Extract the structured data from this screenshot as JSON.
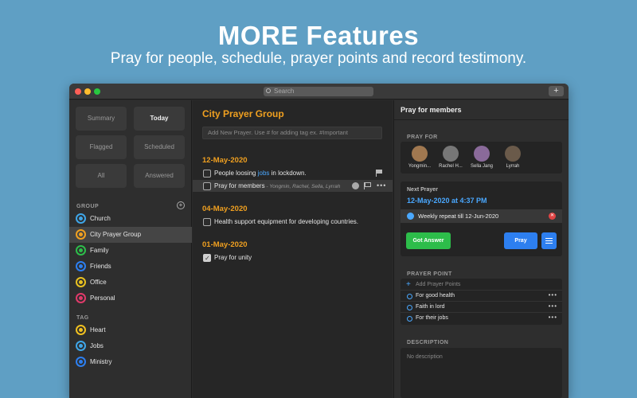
{
  "hero": {
    "title": "MORE Features",
    "subtitle": "Pray for people, schedule, prayer points and record testimony."
  },
  "window": {
    "search_placeholder": "Search",
    "add_label": "+"
  },
  "sidebar": {
    "tiles": {
      "summary": "Summary",
      "today": "Today",
      "flagged": "Flagged",
      "scheduled": "Scheduled",
      "all": "All",
      "answered": "Answered"
    },
    "group_label": "GROUP",
    "group_add": "+",
    "groups": [
      {
        "label": "Church",
        "color": "#3fa6e8"
      },
      {
        "label": "City Prayer Group",
        "color": "#f0a020"
      },
      {
        "label": "Family",
        "color": "#2dbd4a"
      },
      {
        "label": "Friends",
        "color": "#2d7ff0"
      },
      {
        "label": "Office",
        "color": "#e8c020"
      },
      {
        "label": "Personal",
        "color": "#e03a6a"
      }
    ],
    "tag_label": "TAG",
    "tags": [
      {
        "label": "Heart",
        "color": "#f0c020"
      },
      {
        "label": "Jobs",
        "color": "#3fa6e8"
      },
      {
        "label": "Ministry",
        "color": "#2d7ff0"
      }
    ]
  },
  "middle": {
    "title": "City Prayer Group",
    "add_placeholder": "Add New Prayer. Use # for adding tag ex. #Important",
    "sections": [
      {
        "date": "12-May-2020",
        "items": [
          {
            "pre": "People loosing ",
            "highlight": "jobs",
            "post": " in lockdown."
          },
          {
            "text": "Pray for members",
            "members": " - Yongmin, Rachel, Sella, Lyrrah"
          }
        ]
      },
      {
        "date": "04-May-2020",
        "items": [
          {
            "text": "Health support equipment for developing countries."
          }
        ]
      },
      {
        "date": "01-May-2020",
        "items": [
          {
            "text": "Pray for unity"
          }
        ]
      }
    ],
    "more": "•••"
  },
  "right": {
    "header": "Pray for members",
    "pray_for_label": "PRAY FOR",
    "people": [
      {
        "name": "Yongmin...",
        "color": "#a07850"
      },
      {
        "name": "Rachel H...",
        "color": "#777777"
      },
      {
        "name": "Sella Jang",
        "color": "#8a6a9a"
      },
      {
        "name": "Lyrrah",
        "color": "#6a5a4a"
      }
    ],
    "next_prayer_label": "Next Prayer",
    "next_prayer_date": "12-May-2020 at 4:37 PM",
    "repeat_text": "Weekly repeat till 12-Jun-2020",
    "got_answer": "Got Answer",
    "pray": "Pray",
    "prayer_point_label": "PRAYER POINT",
    "add_prayer_points": "Add Prayer Points",
    "points": [
      "For good health",
      "Faith in lord",
      "For their jobs"
    ],
    "description_label": "DESCRIPTION",
    "no_description": "No description",
    "more": "•••"
  }
}
